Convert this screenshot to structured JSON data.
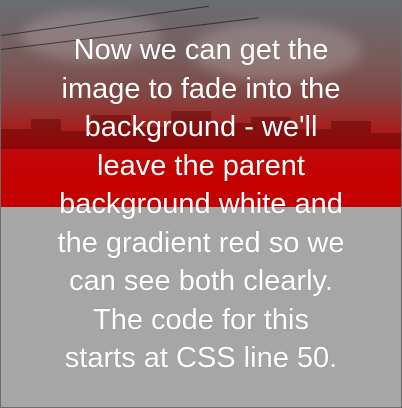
{
  "caption": {
    "lines": [
      "Now we can get the",
      "image to fade into the",
      "background - we'll",
      "leave the parent",
      "background white and",
      "the gradient red so we",
      "can see both clearly.",
      "The code for this",
      "starts at CSS line 50."
    ]
  },
  "colors": {
    "gradient_red": "#c40000",
    "lower_background": "#a6a6a6",
    "text": "#ffffff"
  }
}
